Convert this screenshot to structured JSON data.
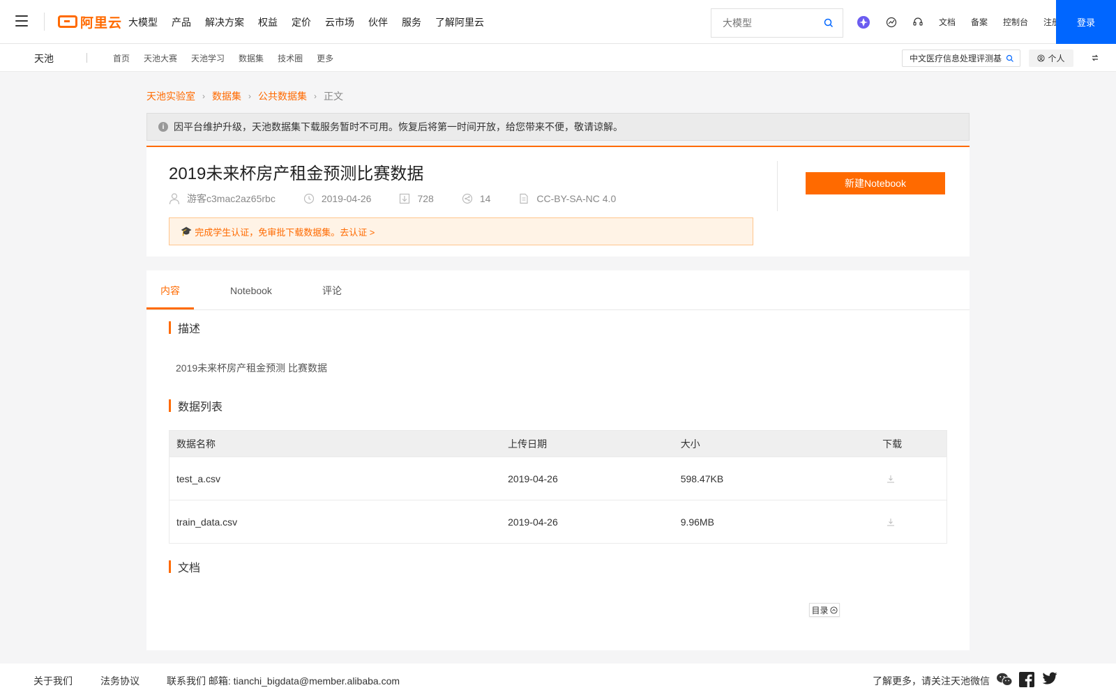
{
  "topnav": {
    "logo_text": "阿里云",
    "menu": [
      "大模型",
      "产品",
      "解决方案",
      "权益",
      "定价",
      "云市场",
      "伙伴",
      "服务",
      "了解阿里云"
    ],
    "search_placeholder": "大模型",
    "tools": [
      "文档",
      "备案",
      "控制台",
      "注册"
    ],
    "login_label": "登录",
    "accent": "#ff6a00",
    "login_color": "#0066ff"
  },
  "subnav": {
    "brand": "天池",
    "links": [
      "首页",
      "天池大赛",
      "天池学习",
      "数据集",
      "技术圈",
      "更多"
    ],
    "search_value": "中文医疗信息处理评测基",
    "personal_label": "个人"
  },
  "breadcrumb": [
    "天池实验室",
    "数据集",
    "公共数据集",
    "正文"
  ],
  "notice": "因平台维护升级，天池数据集下载服务暂时不可用。恢复后将第一时间开放，给您带来不便，敬请谅解。",
  "dataset": {
    "title": "2019未来杯房产租金预测比赛数据",
    "author": "游客c3mac2az65rbc",
    "date": "2019-04-26",
    "downloads": "728",
    "shares": "14",
    "license": "CC-BY-SA-NC 4.0",
    "cert_text": "完成学生认证，免审批下载数据集。去认证 >",
    "new_notebook_label": "新建Notebook"
  },
  "tabs": [
    "内容",
    "Notebook",
    "评论"
  ],
  "sections": {
    "desc_title": "描述",
    "desc_text": "2019未来杯房产租金预测 比赛数据",
    "list_title": "数据列表",
    "doc_title": "文档"
  },
  "table": {
    "headers": [
      "数据名称",
      "上传日期",
      "大小",
      "下载"
    ],
    "rows": [
      {
        "name": "test_a.csv",
        "date": "2019-04-26",
        "size": "598.47KB"
      },
      {
        "name": "train_data.csv",
        "date": "2019-04-26",
        "size": "9.96MB"
      }
    ]
  },
  "toc_label": "目录",
  "footer": {
    "about": "关于我们",
    "legal": "法务协议",
    "contact": "联系我们 邮箱: tianchi_bigdata@member.alibaba.com",
    "follow": "了解更多，请关注天池微信"
  }
}
